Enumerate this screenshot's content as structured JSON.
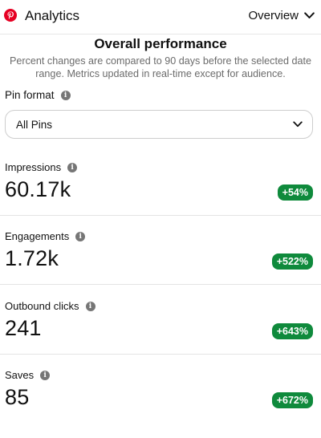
{
  "header": {
    "title": "Analytics",
    "view_selector": "Overview"
  },
  "summary": {
    "heading": "Overall performance",
    "note": "Percent changes are compared to 90 days before the selected date range. Metrics updated in real-time except for audience."
  },
  "filter": {
    "label": "Pin format",
    "selected": "All Pins"
  },
  "metrics": [
    {
      "label": "Impressions",
      "value": "60.17k",
      "change": "+54%"
    },
    {
      "label": "Engagements",
      "value": "1.72k",
      "change": "+522%"
    },
    {
      "label": "Outbound clicks",
      "value": "241",
      "change": "+643%"
    },
    {
      "label": "Saves",
      "value": "85",
      "change": "+672%"
    }
  ],
  "colors": {
    "brand": "#e60023",
    "positive_badge": "#0f8a3c"
  },
  "icons": {
    "logo": "pinterest-logo-icon",
    "view_selector": "chevron-down-icon",
    "info": "info-icon",
    "select": "chevron-down-icon"
  }
}
